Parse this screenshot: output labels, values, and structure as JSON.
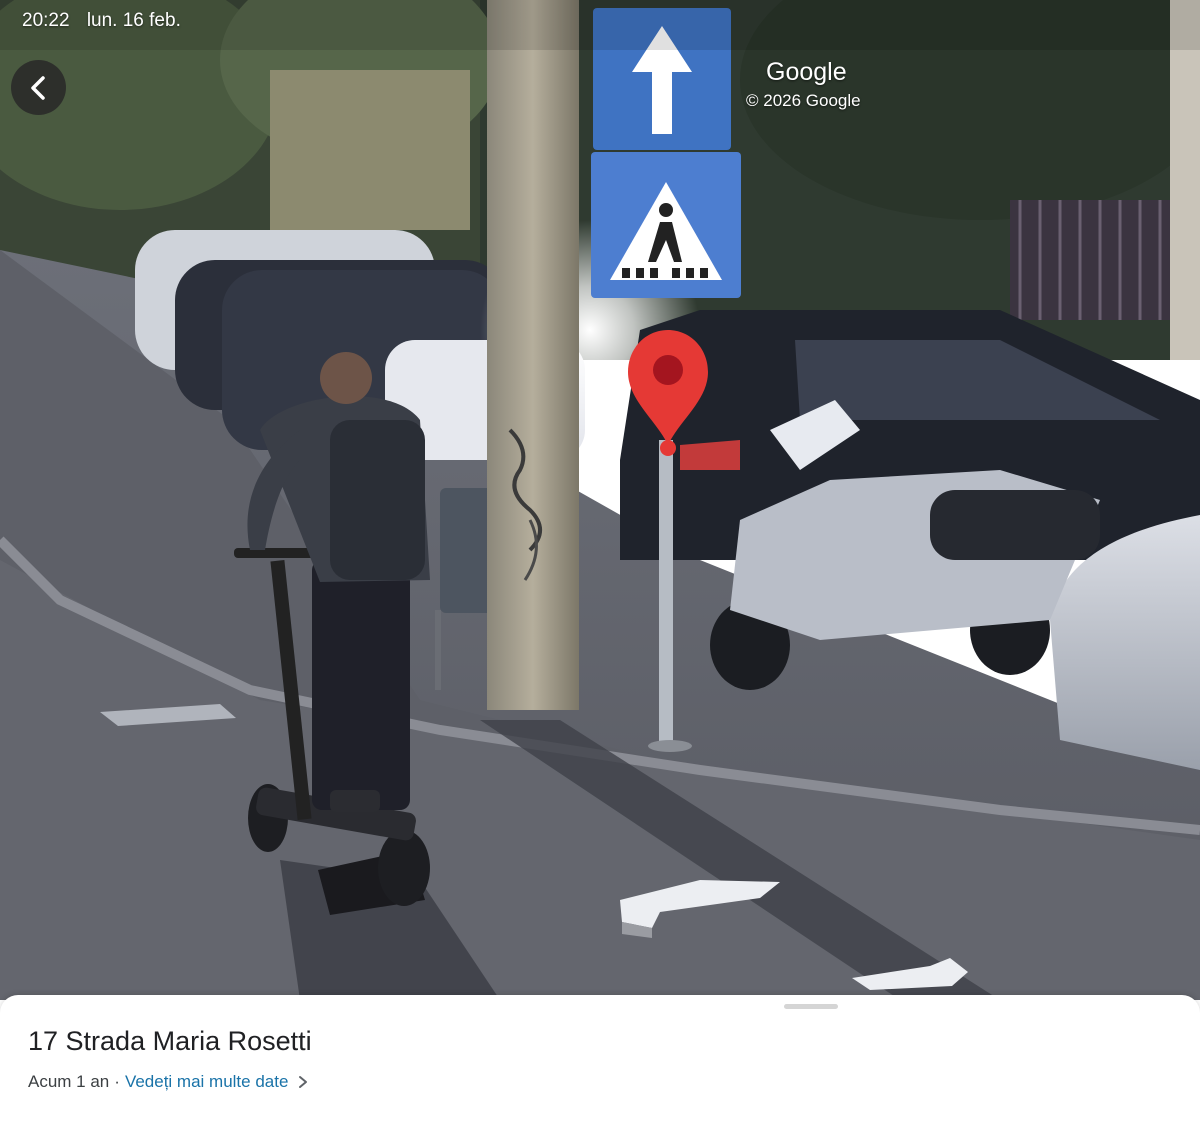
{
  "status_bar": {
    "time": "20:22",
    "date": "lun. 16 feb."
  },
  "back_button": {
    "icon": "chevron-left-icon"
  },
  "watermark": {
    "logo": "Google",
    "copyright": "© 2026 Google"
  },
  "location_sheet": {
    "address": "17 Strada Maria Rosetti",
    "age": "Acum 1 an",
    "separator": "·",
    "more_dates_link": "Vedeți mai multe date",
    "more_dates_icon": "chevron-right-icon"
  },
  "colors": {
    "pin": "#e53935",
    "link": "#1a73a8",
    "sign_blue": "#3f73c2"
  }
}
